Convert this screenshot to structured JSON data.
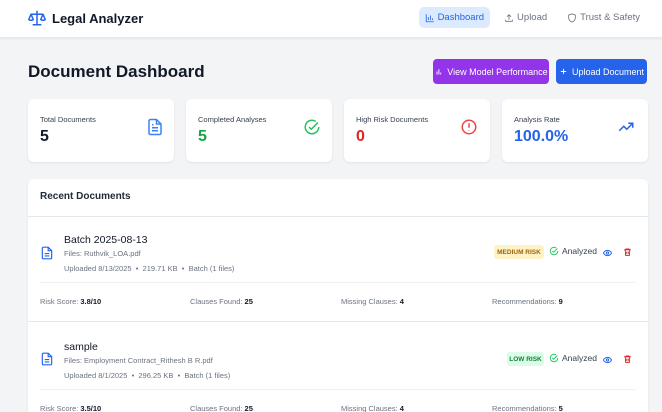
{
  "app": {
    "name": "Legal Analyzer",
    "logo_icon": "scales-icon"
  },
  "nav": [
    {
      "label": "Dashboard",
      "icon": "bar-chart-icon",
      "active": true
    },
    {
      "label": "Upload",
      "icon": "upload-icon",
      "active": false
    },
    {
      "label": "Trust & Safety",
      "icon": "shield-icon",
      "active": false
    }
  ],
  "header": {
    "title": "Document Dashboard",
    "model_button": "View Model Performance",
    "upload_button": "Upload Document"
  },
  "stats": [
    {
      "label": "Total Documents",
      "value": "5",
      "color": "#111827",
      "icon": "document-icon",
      "icon_color": "#3b82f6"
    },
    {
      "label": "Completed Analyses",
      "value": "5",
      "color": "#16a34a",
      "icon": "check-circle-icon",
      "icon_color": "#22c55e"
    },
    {
      "label": "High Risk Documents",
      "value": "0",
      "color": "#dc2626",
      "icon": "alert-circle-icon",
      "icon_color": "#ef4444"
    },
    {
      "label": "Analysis Rate",
      "value": "100.0%",
      "color": "#2563eb",
      "icon": "trending-up-icon",
      "icon_color": "#2563eb"
    }
  ],
  "recent": {
    "title": "Recent Documents",
    "docs": [
      {
        "name": "Batch 2025-08-13",
        "files": "Files: Ruthvik_LOA.pdf",
        "uploaded": "Uploaded 8/13/2025",
        "size": "219.71 KB",
        "batch": "Batch (1 files)",
        "risk": "MEDIUM RISK",
        "risk_bg": "#fef3c7",
        "risk_fg": "#a16207",
        "status": "Analyzed",
        "risk_score_label": "Risk Score:",
        "risk_score": "3.8/10",
        "clauses_label": "Clauses Found:",
        "clauses": "25",
        "missing_label": "Missing Clauses:",
        "missing": "4",
        "recs_label": "Recommendations:",
        "recs": "9"
      },
      {
        "name": "sample",
        "files": "Files: Employment Contract_Rithesh B R.pdf",
        "uploaded": "Uploaded 8/1/2025",
        "size": "296.25 KB",
        "batch": "Batch (1 files)",
        "risk": "LOW RISK",
        "risk_bg": "#dcfce7",
        "risk_fg": "#15803d",
        "status": "Analyzed",
        "risk_score_label": "Risk Score:",
        "risk_score": "3.5/10",
        "clauses_label": "Clauses Found:",
        "clauses": "25",
        "missing_label": "Missing Clauses:",
        "missing": "4",
        "recs_label": "Recommendations:",
        "recs": "5"
      }
    ]
  },
  "separator": "•"
}
